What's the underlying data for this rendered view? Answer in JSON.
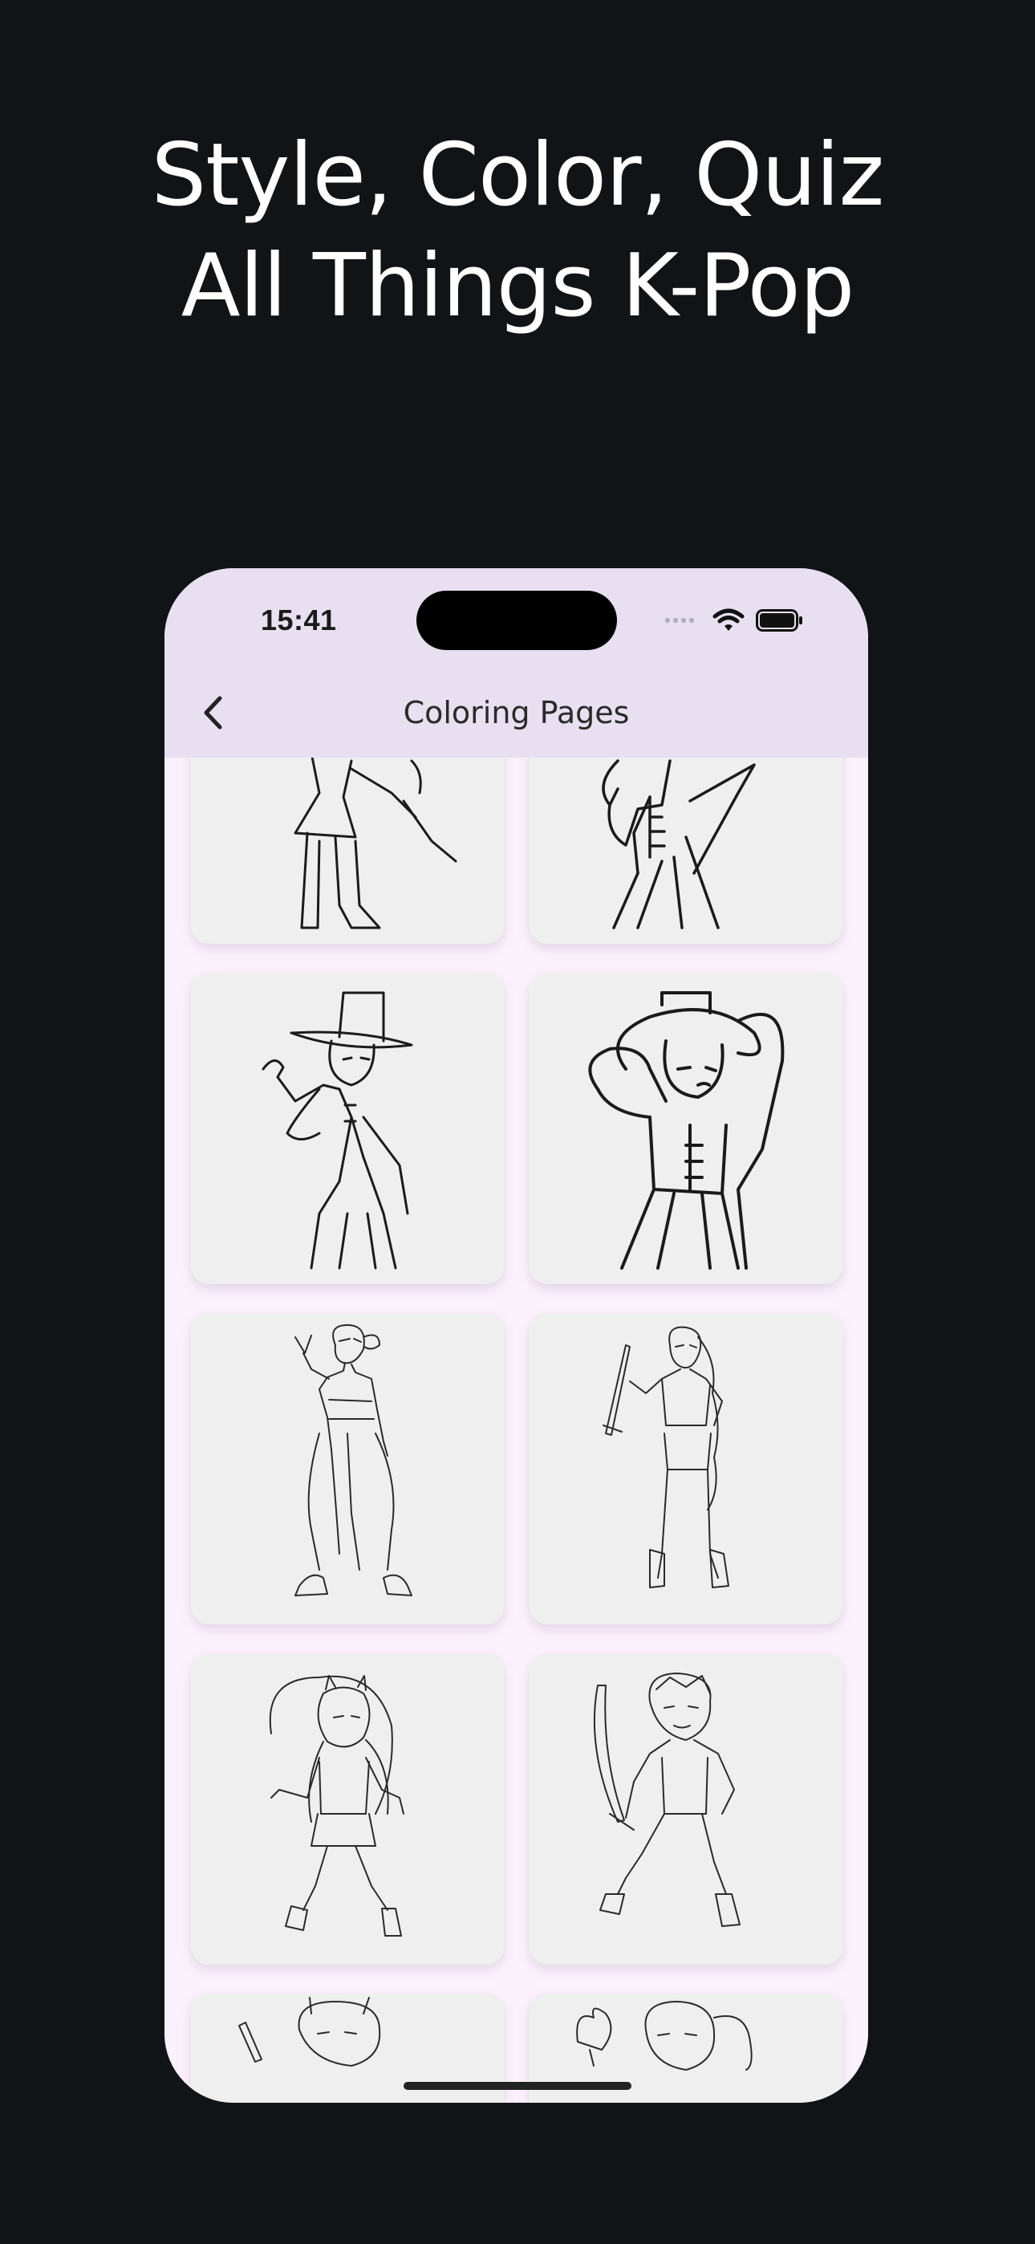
{
  "headline": {
    "line1": "Style, Color, Quiz",
    "line2": "All Things K-Pop"
  },
  "status_bar": {
    "time": "15:41"
  },
  "nav": {
    "title": "Coloring Pages",
    "back_icon": "chevron-left-icon"
  },
  "pages": [
    {
      "name": "coloring-page-1",
      "subject": "girl in skirt and boots"
    },
    {
      "name": "coloring-page-2",
      "subject": "figure in hanbok"
    },
    {
      "name": "coloring-page-3",
      "subject": "figure with gat hat making heart"
    },
    {
      "name": "coloring-page-4",
      "subject": "figure with gat hat, arm raised"
    },
    {
      "name": "coloring-page-5",
      "subject": "dancer with peace sign"
    },
    {
      "name": "coloring-page-6",
      "subject": "girl with braid and sword"
    },
    {
      "name": "coloring-page-7",
      "subject": "girl with horns and whip"
    },
    {
      "name": "coloring-page-8",
      "subject": "boy with sword"
    },
    {
      "name": "coloring-page-9",
      "subject": "boy with horns and flute"
    },
    {
      "name": "coloring-page-10",
      "subject": "girl with ponytail and torch"
    }
  ],
  "colors": {
    "background": "#111417",
    "nav_bar": "#e8e0f0",
    "content": "#fbf1fc",
    "card": "#efefef"
  }
}
